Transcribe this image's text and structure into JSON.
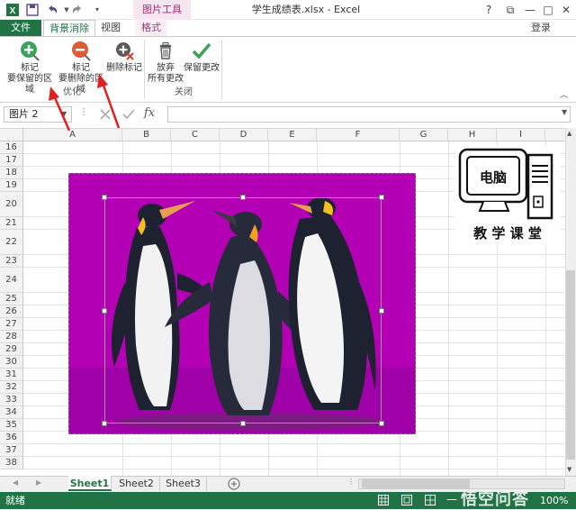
{
  "titlebar": {
    "document_title": "学生成绩表.xlsx - Excel",
    "context_tab": "图片工具",
    "qat": [
      "excel-icon",
      "save-icon",
      "undo-icon",
      "redo-icon",
      "customize-icon"
    ],
    "window_buttons": [
      "?",
      "⧉",
      "—",
      "□",
      "✕"
    ]
  },
  "tabs": {
    "file": "文件",
    "background_removal": "背景消除",
    "view": "视图",
    "format": "格式",
    "login": "登录"
  },
  "ribbon": {
    "mark_keep_line1": "标记",
    "mark_keep_line2": "要保留的区域",
    "mark_remove_line1": "标记",
    "mark_remove_line2": "要删除的区域",
    "delete_mark": "删除标记",
    "discard_line1": "放弃",
    "discard_line2": "所有更改",
    "keep_changes": "保留更改",
    "group_refine": "优化",
    "group_close": "关闭"
  },
  "formula_bar": {
    "name_box": "图片 2",
    "fx": "fx",
    "formula": ""
  },
  "grid": {
    "columns": [
      "A",
      "B",
      "C",
      "D",
      "E",
      "F",
      "G",
      "H",
      "I"
    ],
    "rows": [
      "16",
      "17",
      "18",
      "19",
      "20",
      "21",
      "22",
      "23",
      "24",
      "25",
      "26",
      "27",
      "28",
      "29",
      "30",
      "31",
      "32",
      "33",
      "34",
      "35",
      "36",
      "37",
      "38"
    ]
  },
  "logo": {
    "top_text": "电脑",
    "bottom_text": "教 学 课 堂"
  },
  "sheets": [
    "Sheet1",
    "Sheet2",
    "Sheet3"
  ],
  "status": {
    "text": "就绪",
    "zoom": "100%",
    "watermark": "悟空问答"
  },
  "colors": {
    "excel_green": "#217346",
    "picture_bg": "#b400b4",
    "context_tab": "#a0307a",
    "arrow_red": "#e02020"
  }
}
